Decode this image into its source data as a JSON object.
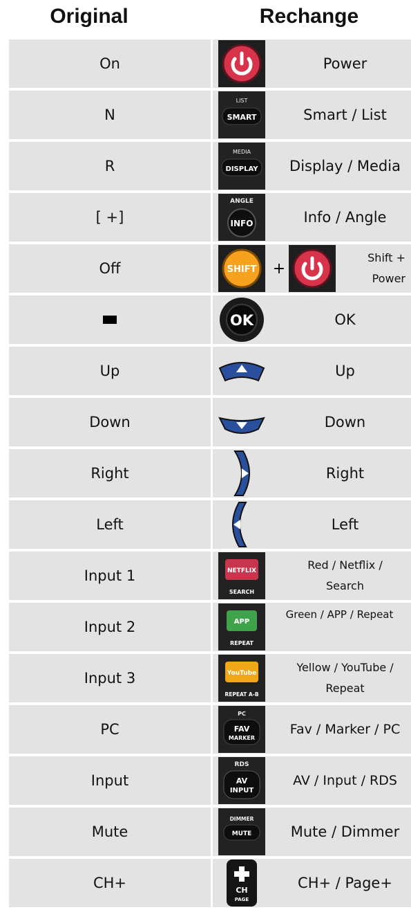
{
  "headers": {
    "original": "Original",
    "rechange": "Rechange"
  },
  "rows": [
    {
      "original": "On",
      "rechange": "Power",
      "icon": "power-button-icon",
      "button_text": ""
    },
    {
      "original": "N",
      "rechange": "Smart / List",
      "icon": "smart-list-button-icon",
      "button_top": "LIST",
      "button_text": "SMART"
    },
    {
      "original": "R",
      "rechange": "Display / Media",
      "icon": "display-media-button-icon",
      "button_top": "MEDIA",
      "button_text": "DISPLAY"
    },
    {
      "original": "[ +]",
      "rechange": "Info / Angle",
      "icon": "info-angle-button-icon",
      "button_top": "ANGLE",
      "button_text": "INFO"
    },
    {
      "original": "Off",
      "rechange_line1": "Shift +",
      "rechange_line2": "Power",
      "plus": "+",
      "icon": "shift-power-button-icon",
      "button_text": "SHIFT"
    },
    {
      "original": "",
      "rechange": "OK",
      "icon": "ok-button-icon",
      "button_text": "OK"
    },
    {
      "original": "Up",
      "rechange": "Up",
      "icon": "up-arrow-button-icon"
    },
    {
      "original": "Down",
      "rechange": "Down",
      "icon": "down-arrow-button-icon"
    },
    {
      "original": "Right",
      "rechange": "Right",
      "icon": "right-arrow-button-icon"
    },
    {
      "original": "Left",
      "rechange": "Left",
      "icon": "left-arrow-button-icon"
    },
    {
      "original": "Input 1",
      "rechange_line1": "Red / Netflix /",
      "rechange_line2": "Search",
      "icon": "netflix-button-icon",
      "button_text": "NETFLIX",
      "button_bottom": "SEARCH"
    },
    {
      "original": "Input 2",
      "rechange_line1": "Green / APP / Repeat",
      "rechange_line2": "",
      "icon": "app-button-icon",
      "button_text": "APP",
      "button_bottom": "REPEAT"
    },
    {
      "original": "Input 3",
      "rechange_line1": "Yellow / YouTube /",
      "rechange_line2": "Repeat",
      "icon": "youtube-button-icon",
      "button_text": "YouTube",
      "button_bottom": "REPEAT A-B"
    },
    {
      "original": "PC",
      "rechange": "Fav / Marker / PC",
      "icon": "fav-marker-button-icon",
      "button_top": "PC",
      "button_text": "FAV",
      "button_text2": "MARKER"
    },
    {
      "original": "Input",
      "rechange": "AV / Input / RDS",
      "icon": "av-input-button-icon",
      "button_top": "RDS",
      "button_text": "AV",
      "button_text2": "INPUT"
    },
    {
      "original": "Mute",
      "rechange": "Mute / Dimmer",
      "icon": "mute-button-icon",
      "button_top": "DIMMER",
      "button_text": "MUTE"
    },
    {
      "original": "CH+",
      "rechange": "CH+ / Page+",
      "icon": "ch-plus-button-icon",
      "button_text": "CH",
      "button_text2": "PAGE"
    }
  ],
  "colors": {
    "cell": "#e3e3e3",
    "power_red": "#d7344c",
    "shift_orange": "#f6a21f",
    "nav_blue": "#2a4f9c",
    "netflix_red": "#c8354f",
    "app_green": "#3ea34a",
    "youtube_yellow": "#f0a818"
  }
}
